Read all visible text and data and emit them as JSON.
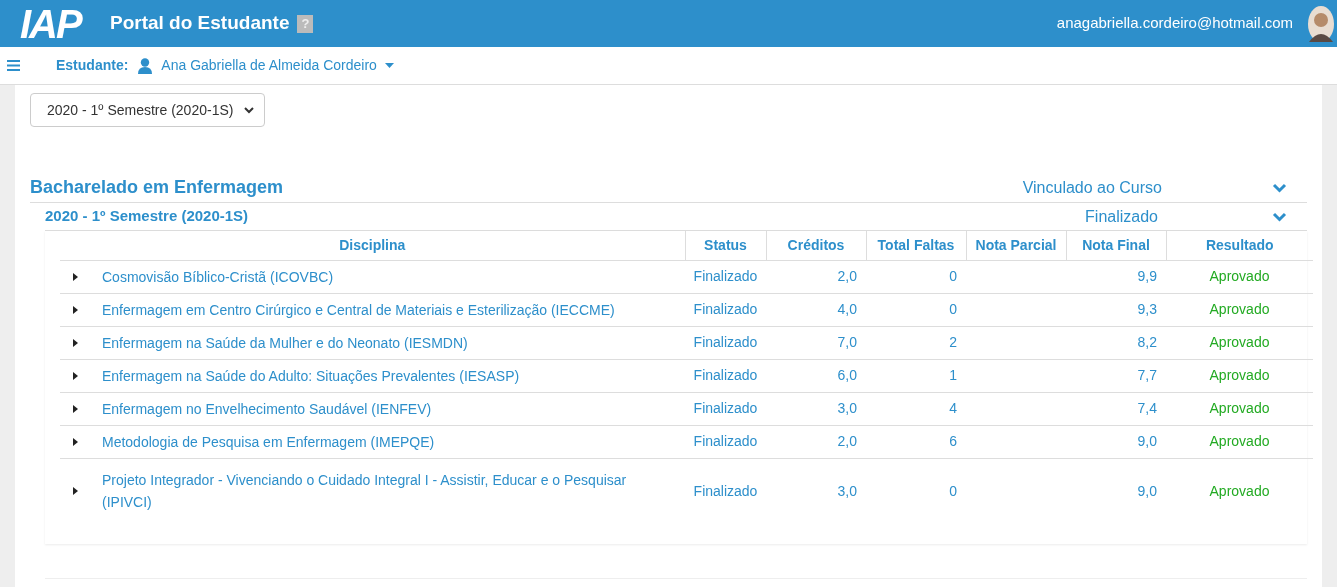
{
  "header": {
    "logo": "IAP",
    "title": "Portal do Estudante",
    "help": "?",
    "email": "anagabriella.cordeiro@hotmail.com"
  },
  "student_bar": {
    "label": "Estudante:",
    "name": "Ana Gabriella de Almeida Cordeiro"
  },
  "period_select": {
    "value": "2020 - 1º Semestre (2020-1S)"
  },
  "course": {
    "name": "Bacharelado em Enfermagem",
    "status": "Vinculado ao Curso",
    "expanded": true
  },
  "semester": {
    "name": "2020 - 1º Semestre (2020-1S)",
    "status": "Finalizado",
    "expanded": true
  },
  "table": {
    "columns": [
      "Disciplina",
      "Status",
      "Créditos",
      "Total Faltas",
      "Nota Parcial",
      "Nota Final",
      "Resultado"
    ],
    "rows": [
      {
        "disciplina": "Cosmovisão Bíblico-Cristã (ICOVBC)",
        "status": "Finalizado",
        "creditos": "2,0",
        "faltas": "0",
        "nota_final": "9,9",
        "resultado": "Aprovado",
        "expanded": false
      },
      {
        "disciplina": "Enfermagem em Centro Cirúrgico e Central de Materiais e Esterilização (IECCME)",
        "status": "Finalizado",
        "creditos": "4,0",
        "faltas": "0",
        "nota_final": "9,3",
        "resultado": "Aprovado",
        "expanded": false
      },
      {
        "disciplina": "Enfermagem na Saúde da Mulher e do Neonato (IESMDN)",
        "status": "Finalizado",
        "creditos": "7,0",
        "faltas": "2",
        "nota_final": "8,2",
        "resultado": "Aprovado",
        "expanded": false
      },
      {
        "disciplina": "Enfermagem na Saúde do Adulto: Situações Prevalentes (IESASP)",
        "status": "Finalizado",
        "creditos": "6,0",
        "faltas": "1",
        "nota_final": "7,7",
        "resultado": "Aprovado",
        "expanded": false
      },
      {
        "disciplina": "Enfermagem no Envelhecimento Saudável (IENFEV)",
        "status": "Finalizado",
        "creditos": "3,0",
        "faltas": "4",
        "nota_final": "7,4",
        "resultado": "Aprovado",
        "expanded": false
      },
      {
        "disciplina": "Metodologia de Pesquisa em Enfermagem (IMEPQE)",
        "status": "Finalizado",
        "creditos": "2,0",
        "faltas": "6",
        "nota_final": "9,0",
        "resultado": "Aprovado",
        "expanded": false
      },
      {
        "disciplina": "Projeto Integrador - Vivenciando o Cuidado Integral I - Assistir, Educar e o Pesquisar (IPIVCI)",
        "status": "Finalizado",
        "creditos": "3,0",
        "faltas": "0",
        "nota_final": "9,0",
        "resultado": "Aprovado",
        "expanded": false
      }
    ]
  }
}
